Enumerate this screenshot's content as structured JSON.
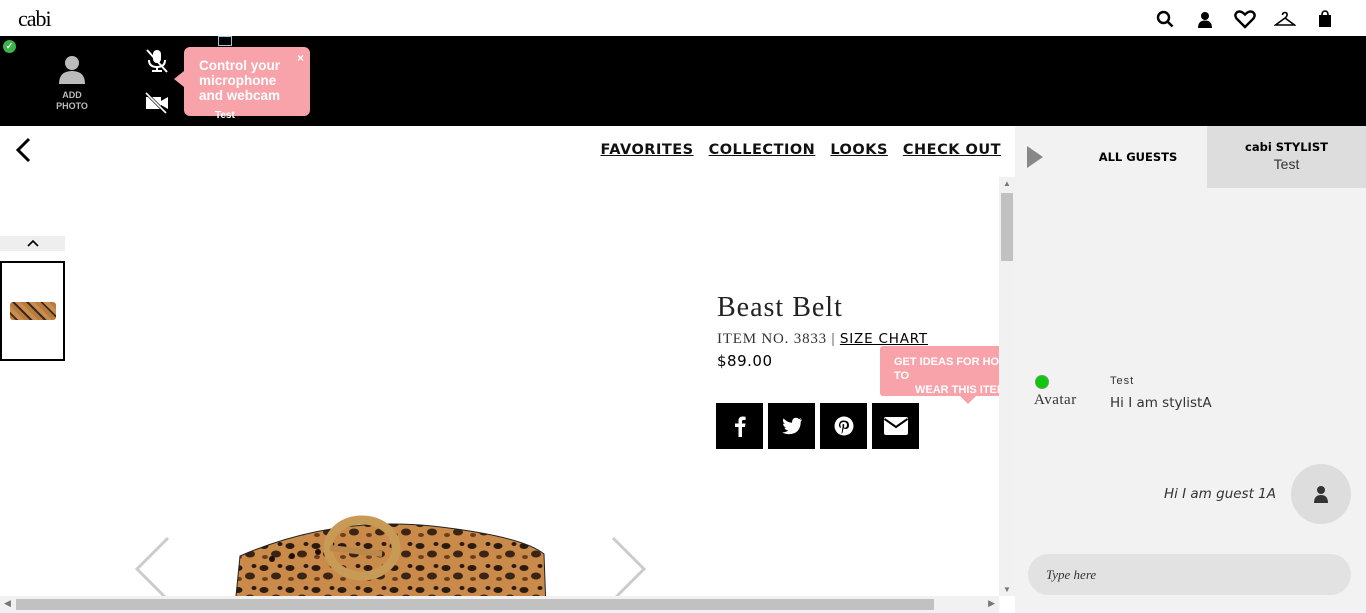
{
  "header": {
    "logo": "cabi",
    "icons": [
      "search-icon",
      "account-icon",
      "heart-icon",
      "hanger-icon",
      "bag-icon"
    ]
  },
  "video": {
    "add_photo_line1": "ADD",
    "add_photo_line2": "PHOTO",
    "tooltip": "Control your microphone and webcam",
    "tooltip_close": "×",
    "participant_label": "Test"
  },
  "nav": {
    "items": [
      "FAVORITES",
      "COLLECTION",
      "LOOKS",
      "CHECK OUT"
    ]
  },
  "product": {
    "title": "Beast Belt",
    "item_no": "ITEM NO. 3833 | ",
    "size_chart": "SIZE CHART",
    "price": "$89.00",
    "ideas_line1": "GET IDEAS FOR HOW TO",
    "ideas_line2": "WEAR THIS ITEM"
  },
  "chat": {
    "tab_all": "ALL GUESTS",
    "tab_stylist_title": "cabi STYLIST",
    "tab_stylist_name": "Test",
    "messages": [
      {
        "avatar_alt": "Avatar",
        "name": "Test",
        "text": "Hi I am stylistA"
      },
      {
        "text": "Hi I am guest 1A"
      }
    ],
    "input_placeholder": "Type here"
  },
  "colors": {
    "accent_pink": "#f7a3a9",
    "online_green": "#11c511",
    "video_bar": "#000000"
  }
}
